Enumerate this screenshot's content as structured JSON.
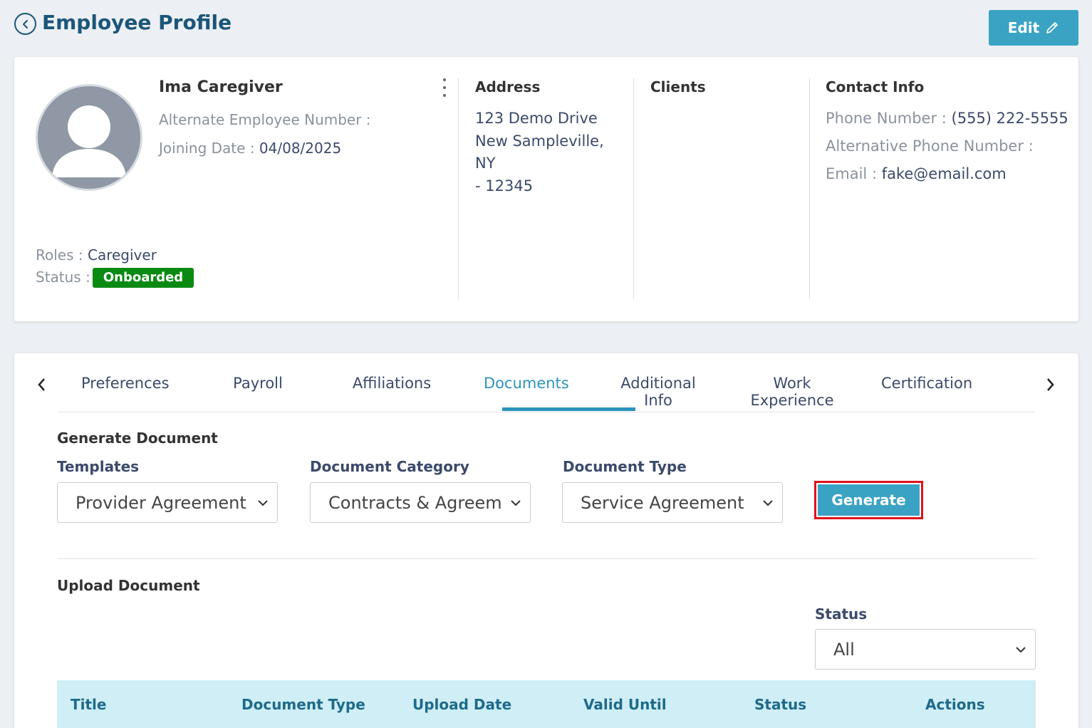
{
  "header": {
    "title": "Employee Profile",
    "edit_label": "Edit"
  },
  "profile": {
    "name": "Ima Caregiver",
    "alt_emp_label": "Alternate Employee Number :",
    "alt_emp_value": "",
    "joining_label": "Joining Date :",
    "joining_value": "04/08/2025",
    "roles_label": "Roles :",
    "roles_value": "Caregiver",
    "status_label": "Status :",
    "status_value": "Onboarded"
  },
  "address": {
    "title": "Address",
    "line1": "123 Demo Drive",
    "line2": "New Sampleville, NY",
    "line3": "- 12345"
  },
  "clients": {
    "title": "Clients"
  },
  "contact": {
    "title": "Contact Info",
    "phone_label": "Phone Number :",
    "phone_value": "(555) 222-5555",
    "alt_phone_label": "Alternative Phone Number :",
    "alt_phone_value": "",
    "email_label": "Email :",
    "email_value": "fake@email.com"
  },
  "tabs": [
    "Preferences",
    "Payroll",
    "Affiliations",
    "Documents",
    "Additional Info",
    "Work Experience",
    "Certification"
  ],
  "active_tab": "Documents",
  "generate": {
    "title": "Generate Document",
    "templates_label": "Templates",
    "templates_value": "Provider Agreement",
    "category_label": "Document Category",
    "category_value": "Contracts & Agreements",
    "type_label": "Document Type",
    "type_value": "Service Agreement",
    "button_label": "Generate"
  },
  "upload": {
    "title": "Upload Document",
    "status_label": "Status",
    "status_value": "All"
  },
  "table": {
    "columns": [
      "Title",
      "Document Type",
      "Upload Date",
      "Valid Until",
      "Status",
      "Actions"
    ]
  },
  "colors": {
    "primary": "#3aa3c3",
    "heading": "#1b5679",
    "status_green": "#0a8a13",
    "highlight": "#e0111b",
    "table_header_bg": "#cfeef6"
  }
}
